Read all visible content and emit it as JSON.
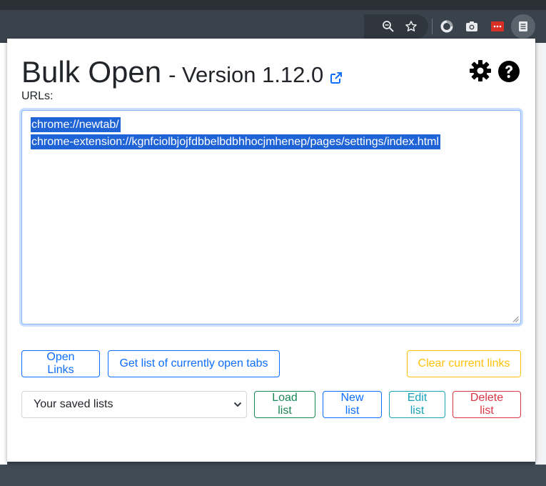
{
  "popup": {
    "title": "Bulk Open",
    "version": "- Version 1.12.0",
    "urls_label": "URLs:",
    "url_lines": [
      "chrome://newtab/",
      "chrome-extension://kgnfciolbjojfdbbelbdbhhocjmhenep/pages/settings/index.html"
    ],
    "buttons": {
      "open_links": "Open Links",
      "get_open_tabs": "Get list of currently open tabs",
      "clear_links": "Clear current links",
      "load_list": "Load list",
      "new_list": "New list",
      "edit_list": "Edit list",
      "delete_list": "Delete list"
    },
    "saved_lists_select": {
      "selected": "Your saved lists"
    }
  },
  "browser": {
    "toolbar_icons": [
      "zoom-icon",
      "bookmark-star-icon",
      "extension-circle-icon",
      "camera-icon",
      "red-extension-icon",
      "bulk-open-extension-icon"
    ]
  },
  "colors": {
    "primary": "#0d6efd",
    "warning": "#ffc107",
    "success": "#198754",
    "info": "#17a2b8",
    "danger": "#dc3545",
    "selection": "#1f64d6"
  }
}
